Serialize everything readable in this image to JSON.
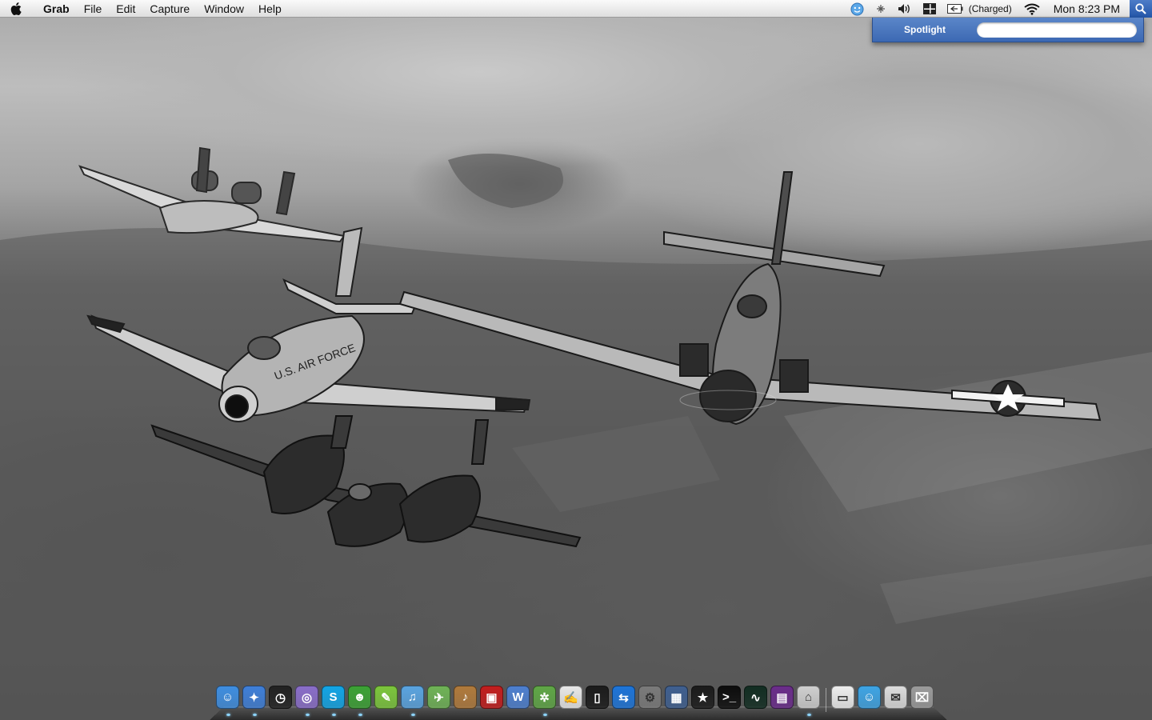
{
  "menubar": {
    "app_name": "Grab",
    "menus": [
      "File",
      "Edit",
      "Capture",
      "Window",
      "Help"
    ],
    "battery_status": "(Charged)",
    "clock": "Mon 8:23 PM",
    "status_icons": [
      "messenger-icon",
      "bluetooth-icon",
      "volume-icon",
      "spaces-icon",
      "battery-icon",
      "wifi-icon"
    ]
  },
  "spotlight": {
    "label": "Spotlight",
    "query": ""
  },
  "dock": {
    "apps": [
      {
        "name": "finder",
        "glyph": "☺",
        "bg": "#3f8ee0",
        "running": true
      },
      {
        "name": "safari",
        "glyph": "✦",
        "bg": "#3f7fd8",
        "running": true
      },
      {
        "name": "clock",
        "glyph": "◷",
        "bg": "#222222",
        "running": false
      },
      {
        "name": "apps",
        "glyph": "◎",
        "bg": "#8a6ec9",
        "running": true
      },
      {
        "name": "skype",
        "glyph": "S",
        "bg": "#12a5e6",
        "running": true
      },
      {
        "name": "adium",
        "glyph": "☻",
        "bg": "#3ca235",
        "running": true
      },
      {
        "name": "utility",
        "glyph": "✎",
        "bg": "#7cc63c",
        "running": false
      },
      {
        "name": "itunes",
        "glyph": "♫",
        "bg": "#5aa4e0",
        "running": true
      },
      {
        "name": "mail-plane",
        "glyph": "✈",
        "bg": "#6fb356",
        "running": false
      },
      {
        "name": "garageband",
        "glyph": "♪",
        "bg": "#b07a3c",
        "running": false
      },
      {
        "name": "photo-booth",
        "glyph": "▣",
        "bg": "#c21d1d",
        "running": false
      },
      {
        "name": "writer",
        "glyph": "W",
        "bg": "#4d7fcf",
        "running": false
      },
      {
        "name": "network",
        "glyph": "✲",
        "bg": "#5fa646",
        "running": true
      },
      {
        "name": "textedit",
        "glyph": "✍",
        "bg": "#e8e8e8",
        "running": false
      },
      {
        "name": "iphone",
        "glyph": "▯",
        "bg": "#1b1b1b",
        "running": false
      },
      {
        "name": "teamviewer",
        "glyph": "⇆",
        "bg": "#1d74d8",
        "running": false
      },
      {
        "name": "preferences",
        "glyph": "⚙",
        "bg": "#7a7a7a",
        "running": false
      },
      {
        "name": "dashboard",
        "glyph": "▦",
        "bg": "#3f5f8f",
        "running": false
      },
      {
        "name": "army",
        "glyph": "★",
        "bg": "#1b1b1b",
        "running": false
      },
      {
        "name": "terminal",
        "glyph": ">_",
        "bg": "#0d0d0d",
        "running": false
      },
      {
        "name": "activity-monitor",
        "glyph": "∿",
        "bg": "#122d22",
        "running": false
      },
      {
        "name": "flash",
        "glyph": "▤",
        "bg": "#6a2c8a",
        "running": false
      },
      {
        "name": "package",
        "glyph": "⌂",
        "bg": "#cfcfcf",
        "running": true
      }
    ],
    "stack_items": [
      {
        "name": "documents",
        "glyph": "▭",
        "bg": "#eeeeee",
        "running": false
      },
      {
        "name": "messenger",
        "glyph": "☺",
        "bg": "#3ea4e4",
        "running": false
      },
      {
        "name": "mailbox",
        "glyph": "✉",
        "bg": "#dcdcdc",
        "running": false
      },
      {
        "name": "trash",
        "glyph": "⌧",
        "bg": "#9a9a9a",
        "running": false
      }
    ]
  }
}
